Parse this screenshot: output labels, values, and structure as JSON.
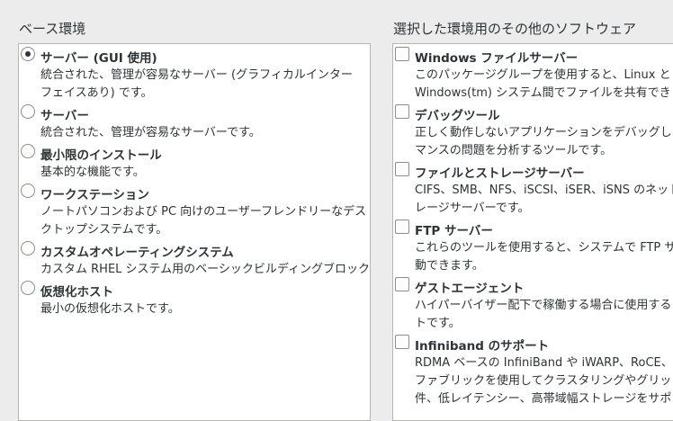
{
  "base_env": {
    "title": "ベース環境",
    "items": [
      {
        "name": "サーバー (GUI 使用)",
        "desc": "統合された、管理が容易なサーバー (グラフィカルインター\nフェイスあり) です。",
        "selected": true
      },
      {
        "name": "サーバー",
        "desc": "統合された、管理が容易なサーバーです。",
        "selected": false
      },
      {
        "name": "最小限のインストール",
        "desc": "基本的な機能です。",
        "selected": false
      },
      {
        "name": "ワークステーション",
        "desc": "ノートパソコンおよび PC 向けのユーザーフレンドリーなデス\nクトップシステムです。",
        "selected": false
      },
      {
        "name": "カスタムオペレーティングシステム",
        "desc": "カスタム RHEL システム用のベーシックビルディングブロック",
        "selected": false
      },
      {
        "name": "仮想化ホスト",
        "desc": "最小の仮想化ホストです。",
        "selected": false
      }
    ]
  },
  "addons": {
    "title": "選択した環境用のその他のソフトウェア",
    "items": [
      {
        "name": "Windows ファイルサーバー",
        "desc": "このパッケージグループを使用すると、Linux と M\nWindows(tm) システム間でファイルを共有できま",
        "checked": false
      },
      {
        "name": "デバッグツール",
        "desc": "正しく動作しないアプリケーションをデバッグし\nマンスの問題を分析するツールです。",
        "checked": false
      },
      {
        "name": "ファイルとストレージサーバー",
        "desc": "CIFS、SMB、NFS、iSCSI、iSER、iSNS のネット\nレージサーバーです。",
        "checked": false
      },
      {
        "name": "FTP サーバー",
        "desc": "これらのツールを使用すると、システムで FTP サ\n動できます。",
        "checked": false
      },
      {
        "name": "ゲストエージェント",
        "desc": "ハイパーバイザー配下で稼働する場合に使用する\nトです。",
        "checked": false
      },
      {
        "name": "Infiniband のサポート",
        "desc": "RDMA ベースの InfiniBand や iWARP、RoCE、お\nファブリックを使用してクラスタリングやグリッ\n件、低レイテンシー、高帯域幅ストレージをサポ",
        "checked": false
      }
    ]
  }
}
